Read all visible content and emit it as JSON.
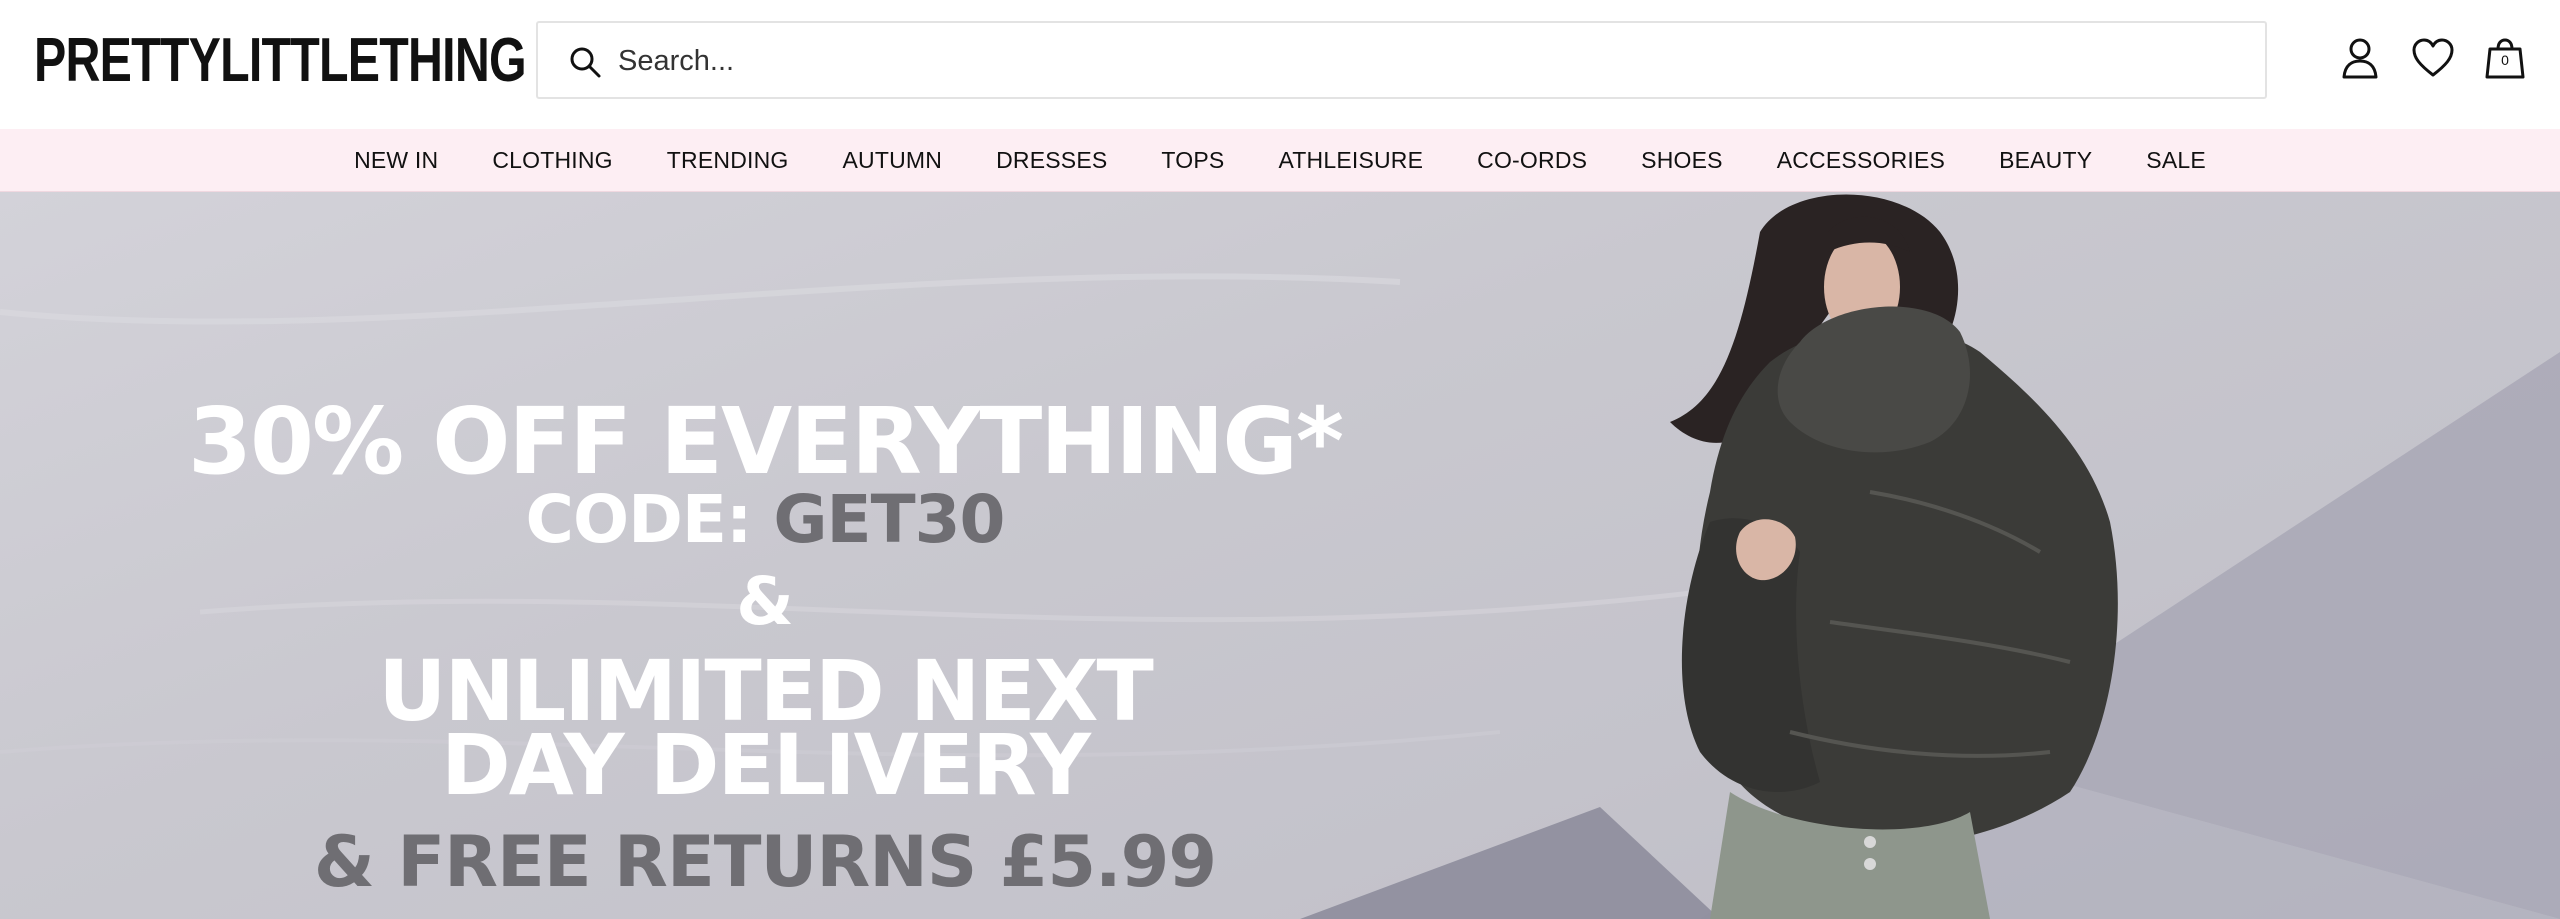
{
  "header": {
    "logo": "PRETTYLITTLETHING",
    "search": {
      "placeholder": "Search..."
    },
    "bag_count": "0"
  },
  "nav": {
    "items": [
      "NEW IN",
      "CLOTHING",
      "TRENDING",
      "AUTUMN",
      "DRESSES",
      "TOPS",
      "ATHLEISURE",
      "CO-ORDS",
      "SHOES",
      "ACCESSORIES",
      "BEAUTY",
      "SALE"
    ]
  },
  "hero": {
    "headline": "30% OFF EVERYTHING*",
    "code_prefix": "CODE:",
    "code": "GET30",
    "ampersand": "&",
    "delivery_line1": "UNLIMITED NEXT",
    "delivery_line2": "DAY DELIVERY",
    "returns": "& FREE RETURNS £5.99"
  },
  "colors": {
    "nav_bg": "#fdeef3",
    "hero_text": "#ffffff",
    "hero_accent_text": "#6f6e73"
  },
  "icons": [
    "search-icon",
    "account-icon",
    "heart-icon",
    "bag-icon"
  ]
}
